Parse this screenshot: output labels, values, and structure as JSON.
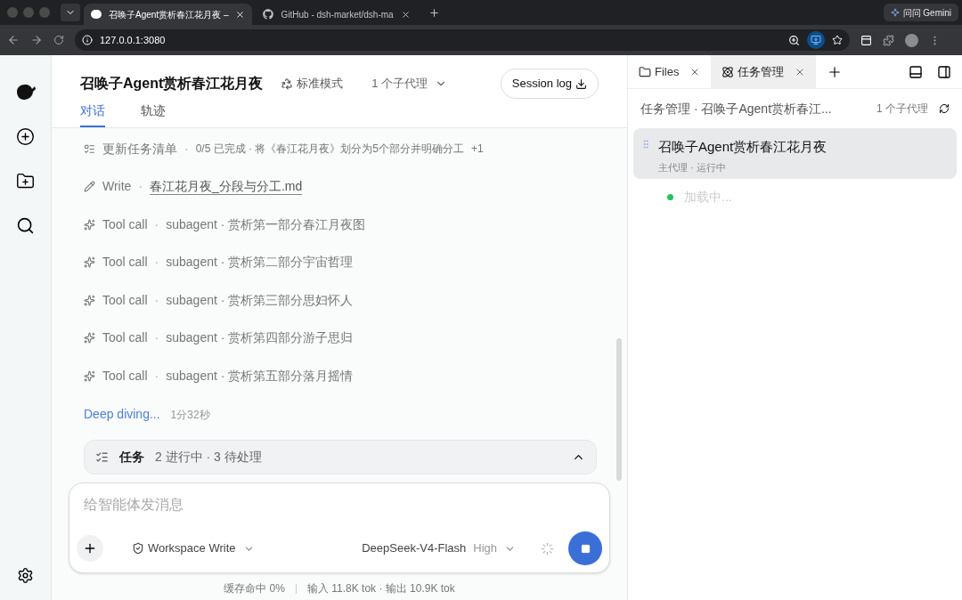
{
  "browser": {
    "tabs": [
      {
        "title": "召唤子Agent赏析春江花月夜 –",
        "kind": "app",
        "selected": true
      },
      {
        "title": "GitHub - dsh-market/dsh-ma",
        "kind": "github",
        "selected": false
      }
    ],
    "address": "127.0.0.1:3080",
    "assistant": "问问 Gemini"
  },
  "header": {
    "title": "召唤子Agent赏析春江花月夜",
    "mode": "标准模式",
    "subagents": "1 个子代理",
    "session_log": "Session log"
  },
  "tabs": [
    {
      "label": "对话",
      "selected": true
    },
    {
      "label": "轨迹",
      "selected": false
    }
  ],
  "steps": [
    {
      "kind": "todo",
      "label": "更新任务清单",
      "sep": "·",
      "detail": "0/5 已完成 · 将《春江花月夜》划分为5个部分并明确分工",
      "extra": "+1"
    },
    {
      "kind": "write",
      "label": "Write",
      "sep": "·",
      "detail": "春江花月夜_分段与分工.md"
    },
    {
      "kind": "tool",
      "label": "Tool call",
      "sep": "·",
      "detail": "subagent · 赏析第一部分春江月夜图"
    },
    {
      "kind": "tool",
      "label": "Tool call",
      "sep": "·",
      "detail": "subagent · 赏析第二部分宇宙哲理"
    },
    {
      "kind": "tool",
      "label": "Tool call",
      "sep": "·",
      "detail": "subagent · 赏析第三部分思妇怀人"
    },
    {
      "kind": "tool",
      "label": "Tool call",
      "sep": "·",
      "detail": "subagent · 赏析第四部分游子思归"
    },
    {
      "kind": "tool",
      "label": "Tool call",
      "sep": "·",
      "detail": "subagent · 赏析第五部分落月摇情"
    }
  ],
  "status": {
    "text": "Deep diving...",
    "elapsed": "1分32秒"
  },
  "tasks": {
    "label": "任务",
    "summary": "2 进行中 · 3 待处理",
    "expanded": true
  },
  "composer": {
    "placeholder": "给智能体发消息",
    "permission": "Workspace Write",
    "model": "DeepSeek-V4-Flash",
    "effort": "High"
  },
  "footer": {
    "cache": "缓存命中 0%",
    "tokens": "输入 11.8K tok · 输出 10.9K tok"
  },
  "panel": {
    "tabs": [
      {
        "label": "Files",
        "kind": "files",
        "selected": false
      },
      {
        "label": "任务管理",
        "kind": "tasks",
        "selected": true
      }
    ],
    "title": "任务管理 · 召唤子Agent赏析春江...",
    "count": "1 个子代理",
    "agent": {
      "title": "召唤子Agent赏析春江花月夜",
      "subtitle": "主代理 · 运行中",
      "selected": true,
      "children": [
        {
          "label": "加载中...",
          "color": "#22c55e"
        }
      ]
    }
  }
}
